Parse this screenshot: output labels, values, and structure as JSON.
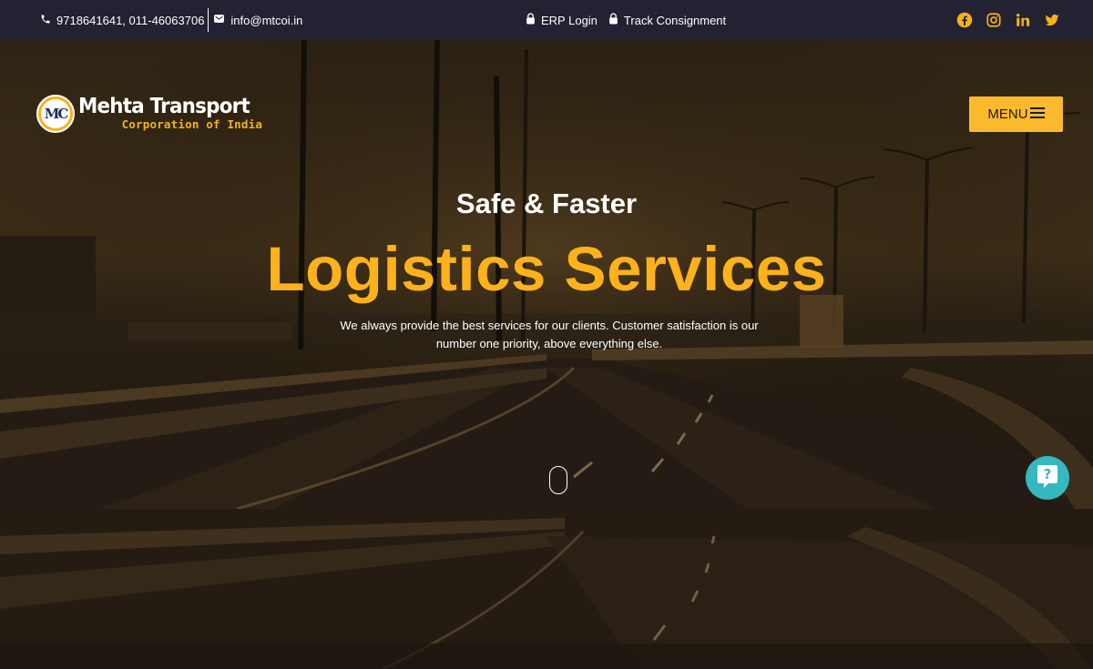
{
  "topbar": {
    "phone": "9718641641, 011-46063706",
    "email": "info@mtcoi.in",
    "erp_login": "ERP Login",
    "track": "Track Consignment",
    "social": [
      "facebook-icon",
      "instagram-icon",
      "linkedin-icon",
      "twitter-icon"
    ]
  },
  "logo": {
    "monogram": "MC",
    "title": "Mehta Transport",
    "subtitle": "Corporation of India"
  },
  "menu": {
    "label": "MENU"
  },
  "hero": {
    "eyebrow": "Safe & Faster",
    "title": "Logistics Services",
    "description": "We always provide the best services for our clients. Customer satisfaction is our number one priority, above everything else."
  },
  "help": {
    "icon": "question-chat-icon"
  },
  "colors": {
    "topbar_bg": "#222232",
    "accent": "#fdb21b",
    "menu_bg": "#fbb92e",
    "help_bg": "#35b8c0"
  }
}
